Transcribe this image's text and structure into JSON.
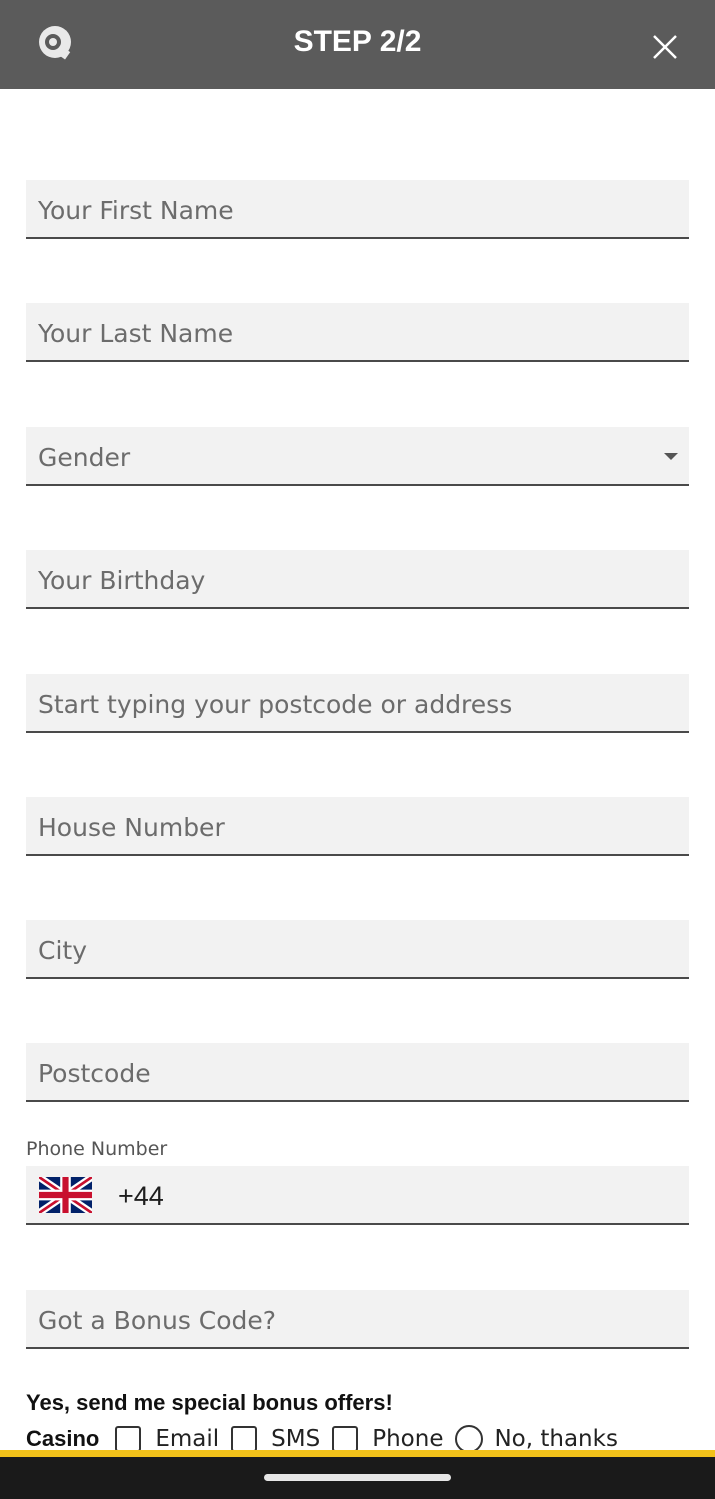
{
  "header": {
    "title": "STEP 2/2",
    "logo_icon": "brand-q-logo",
    "close_icon": "close-icon",
    "background": "#5b5b5b"
  },
  "form": {
    "first_name": {
      "placeholder": "Your First Name"
    },
    "last_name": {
      "placeholder": "Your Last Name"
    },
    "gender": {
      "placeholder": "Gender",
      "icon": "chevron-down-icon"
    },
    "birthday": {
      "placeholder": "Your Birthday"
    },
    "address": {
      "placeholder": "Start typing your postcode or address"
    },
    "house_number": {
      "placeholder": "House Number"
    },
    "city": {
      "placeholder": "City"
    },
    "postcode": {
      "placeholder": "Postcode"
    },
    "phone": {
      "label": "Phone Number",
      "country_icon": "uk-flag-icon",
      "code": "+44"
    },
    "bonus_code": {
      "placeholder": "Got a Bonus Code?"
    }
  },
  "marketing": {
    "heading": "Yes, send me special bonus offers!",
    "category": "Casino",
    "options": [
      "Email",
      "SMS",
      "Phone"
    ],
    "decline": "No, thanks"
  },
  "colors": {
    "field_bg": "#f2f2f2",
    "field_border": "#4a4a4a",
    "accent_yellow": "#f2c11a"
  }
}
